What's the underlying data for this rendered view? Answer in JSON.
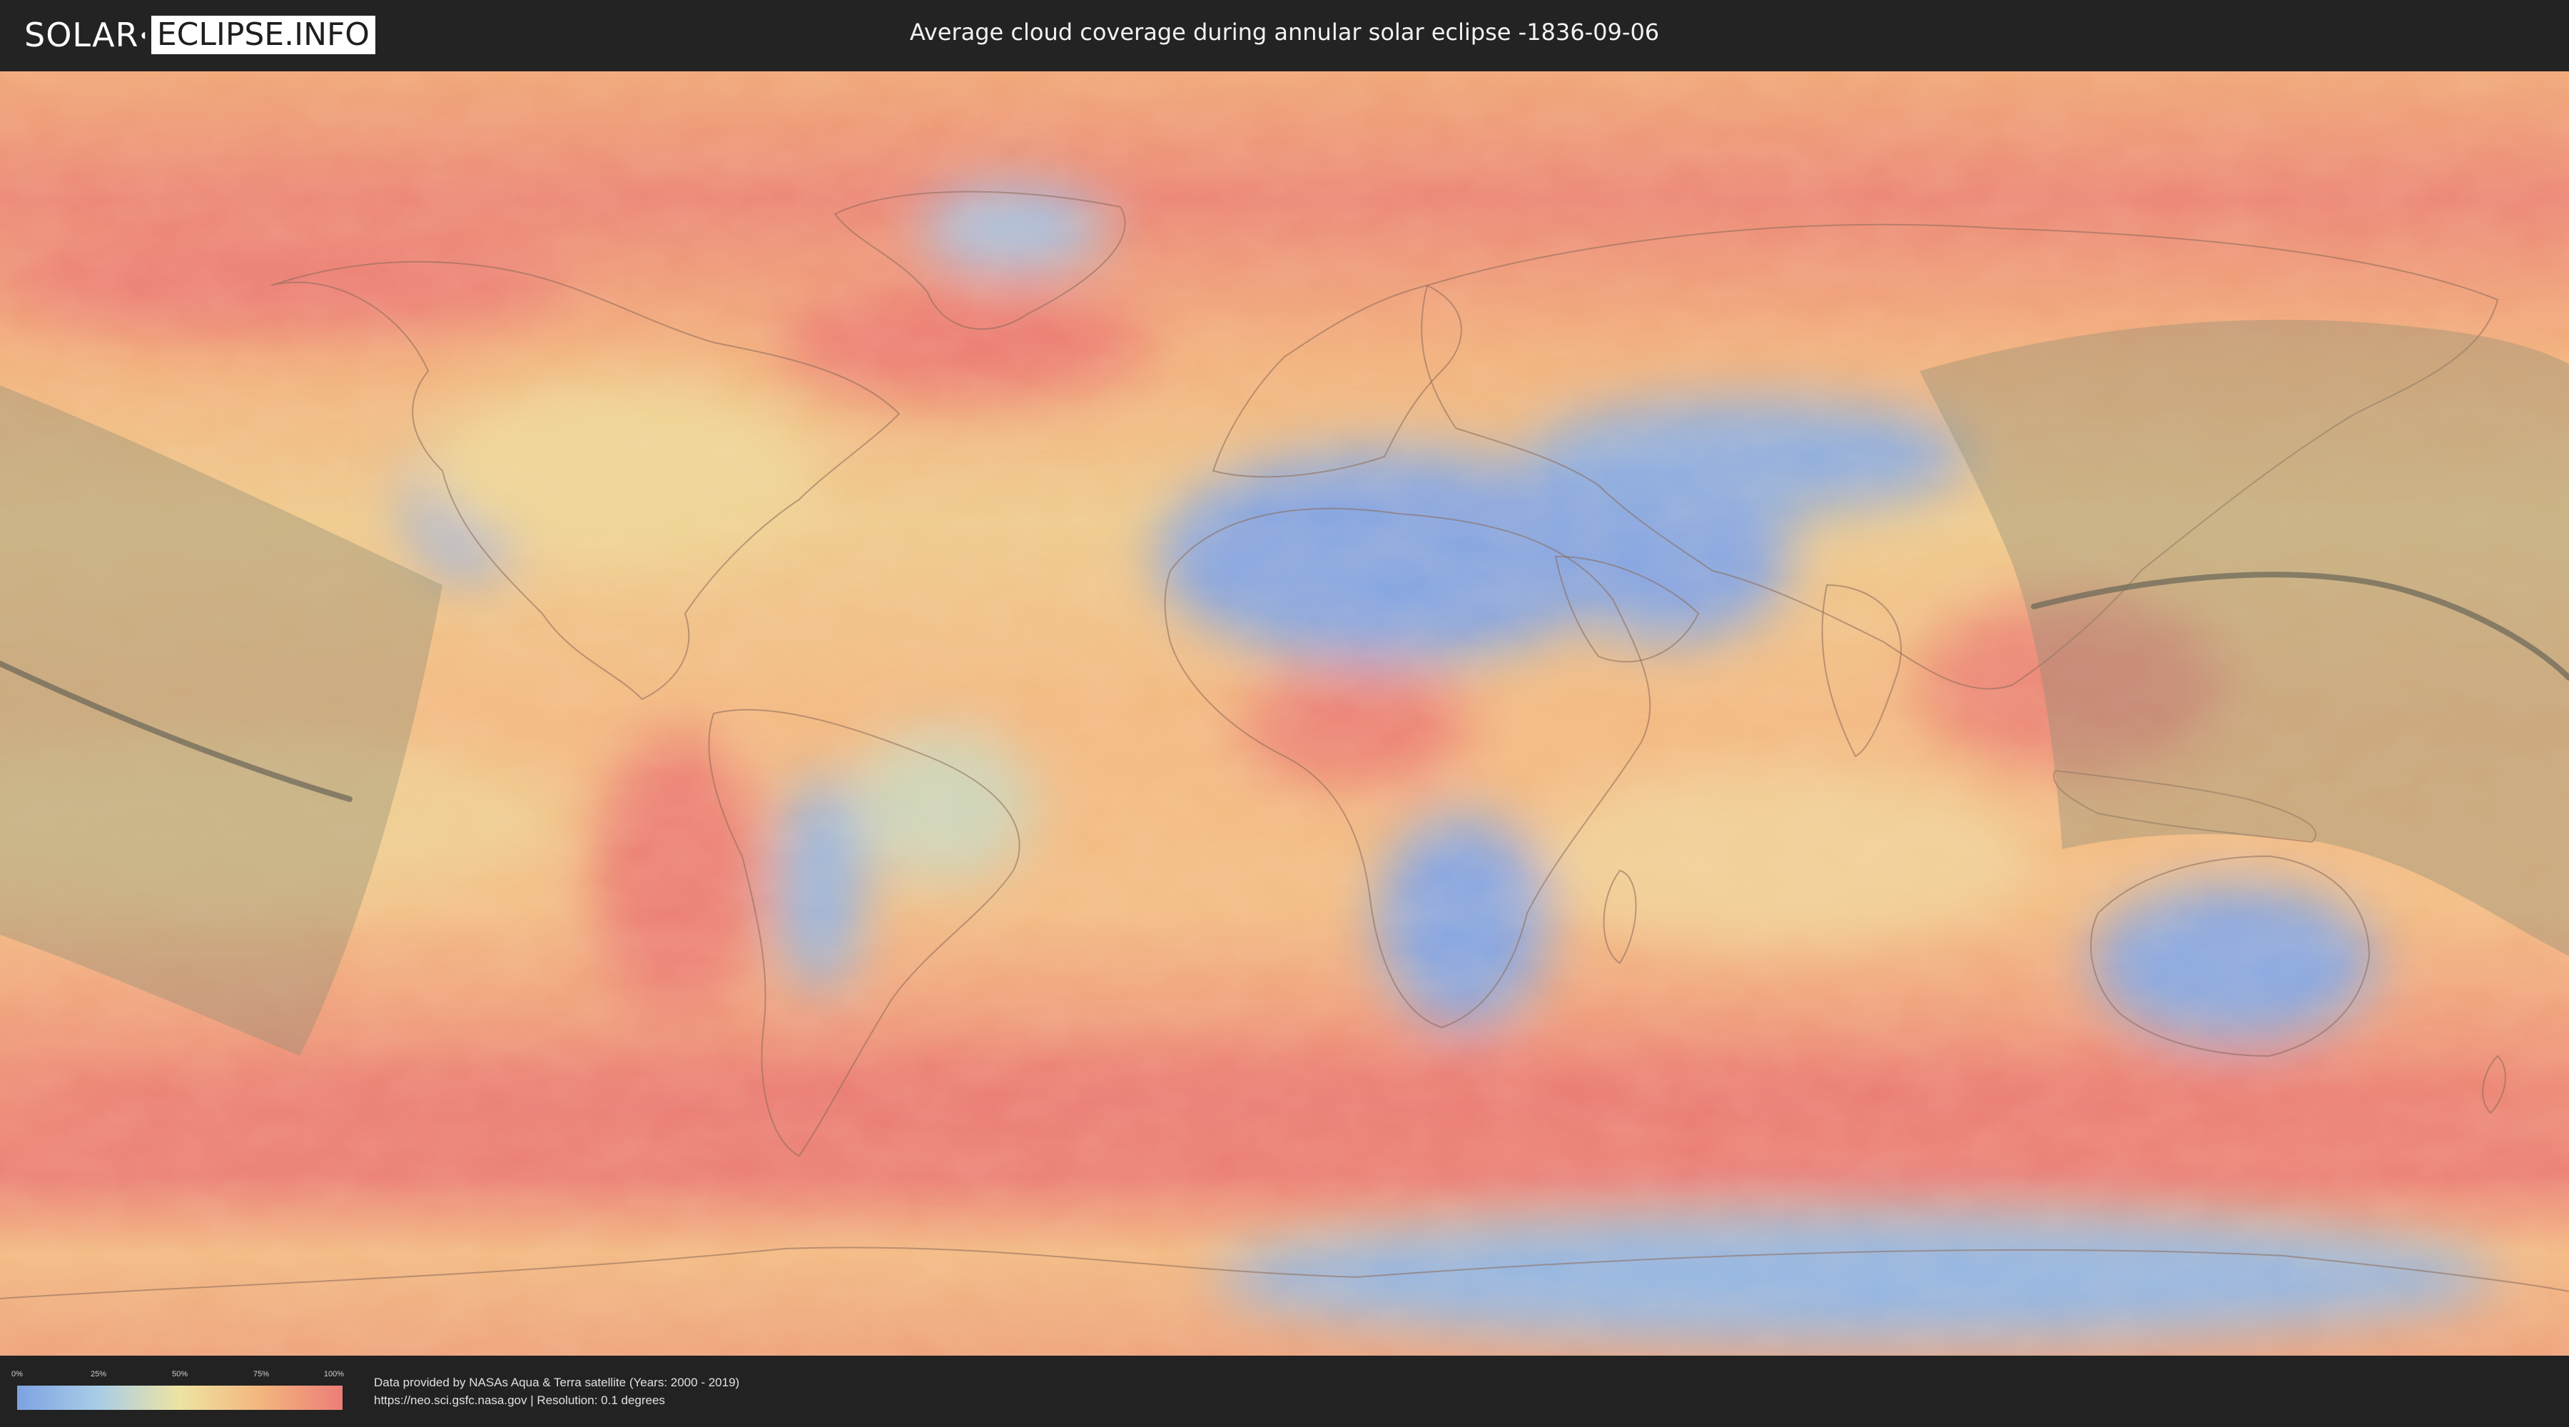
{
  "header": {
    "logo_left": "SOLAR",
    "logo_right": "ECLIPSE.INFO",
    "title": "Average cloud coverage during annular solar eclipse -1836-09-06"
  },
  "map": {
    "projection": "equirectangular",
    "layers": [
      "cloud-coverage-heatmap",
      "country-borders",
      "eclipse-visibility-zone",
      "annular-central-path"
    ]
  },
  "legend": {
    "ticks": [
      "0%",
      "25%",
      "50%",
      "75%",
      "100%"
    ],
    "colors": [
      "#7ea2e2",
      "#a9cde6",
      "#eee3a2",
      "#f3b57e",
      "#ec7e78"
    ]
  },
  "footer": {
    "credit_line1": "Data provided by NASAs Aqua & Terra satellite (Years: 2000 - 2019)",
    "credit_line2": "https://neo.sci.gsfc.nasa.gov | Resolution: 0.1 degrees"
  },
  "colors": {
    "header_bg": "#232323",
    "clear_sky": "#7ea2e2",
    "cloudy": "#ec7e78",
    "eclipse_zone": "#8a8a6a",
    "central_line": "#6f6a5a"
  }
}
